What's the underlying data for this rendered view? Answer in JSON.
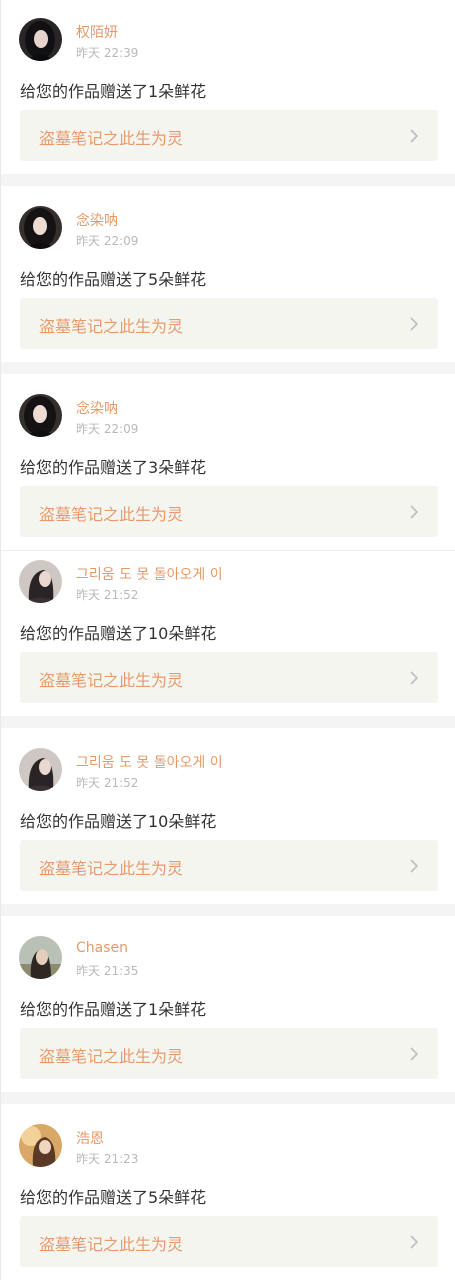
{
  "notifications": [
    {
      "name": "权陌妍",
      "time": "昨天 22:39",
      "message": "给您的作品赠送了1朵鲜花",
      "work_title": "盗墓笔记之此生为灵",
      "avatar_icon": "avatar-dark-hair-portrait"
    },
    {
      "name": "念染呐",
      "time": "昨天 22:09",
      "message": "给您的作品赠送了5朵鲜花",
      "work_title": "盗墓笔记之此生为灵",
      "avatar_icon": "avatar-dark-hair-portrait"
    },
    {
      "name": "念染呐",
      "time": "昨天 22:09",
      "message": "给您的作品赠送了3朵鲜花",
      "work_title": "盗墓笔记之此生为灵",
      "avatar_icon": "avatar-dark-hair-portrait"
    },
    {
      "name": "그리움 도 못 돌아오게 이",
      "time": "昨天 21:52",
      "message": "给您的作品赠送了10朵鲜花",
      "work_title": "盗墓笔记之此生为灵",
      "avatar_icon": "avatar-profile-portrait"
    },
    {
      "name": "그리움 도 못 돌아오게 이",
      "time": "昨天 21:52",
      "message": "给您的作品赠送了10朵鲜花",
      "work_title": "盗墓笔记之此生为灵",
      "avatar_icon": "avatar-profile-portrait"
    },
    {
      "name": "Chasen",
      "time": "昨天 21:35",
      "message": "给您的作品赠送了1朵鲜花",
      "work_title": "盗墓笔记之此生为灵",
      "avatar_icon": "avatar-outdoor-portrait"
    },
    {
      "name": "浩恩",
      "time": "昨天 21:23",
      "message": "给您的作品赠送了5朵鲜花",
      "work_title": "盗墓笔记之此生为灵",
      "avatar_icon": "avatar-warm-tone-portrait"
    }
  ],
  "colors": {
    "username": "#e49a6a",
    "work_title": "#e79a6c",
    "timestamp": "#b9b9b9",
    "message": "#333333",
    "work_card_bg": "#f5f5f0",
    "separator": "#f4f4f4"
  }
}
